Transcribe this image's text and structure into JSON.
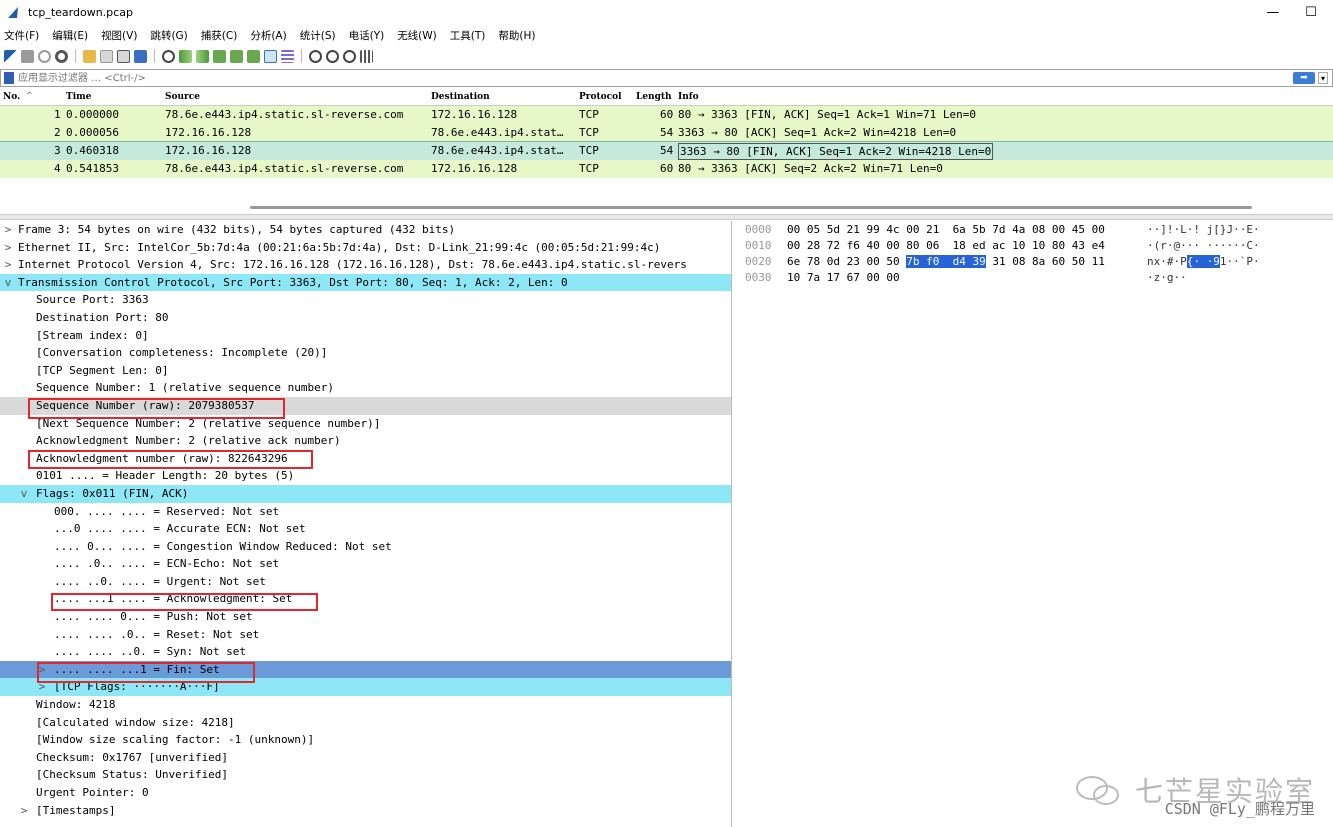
{
  "window": {
    "title": "tcp_teardown.pcap",
    "minimize": "—",
    "maximize": "☐"
  },
  "menu": [
    "文件(F)",
    "编辑(E)",
    "视图(V)",
    "跳转(G)",
    "捕获(C)",
    "分析(A)",
    "统计(S)",
    "电话(Y)",
    "无线(W)",
    "工具(T)",
    "帮助(H)"
  ],
  "filter": {
    "placeholder": "应用显示过滤器 … <Ctrl-/>",
    "apply_icon": "arrow-right-icon",
    "dropdown": "▾"
  },
  "packet_list": {
    "headers": {
      "no": "No.",
      "time": "Time",
      "source": "Source",
      "destination": "Destination",
      "protocol": "Protocol",
      "length": "Length",
      "info": "Info"
    },
    "rows": [
      {
        "no": "1",
        "time": "0.000000",
        "source": "78.6e.e443.ip4.static.sl-reverse.com",
        "destination": "172.16.16.128",
        "protocol": "TCP",
        "length": "60",
        "info": "80 → 3363 [FIN, ACK] Seq=1 Ack=1 Win=71 Len=0"
      },
      {
        "no": "2",
        "time": "0.000056",
        "source": "172.16.16.128",
        "destination": "78.6e.e443.ip4.stat…",
        "protocol": "TCP",
        "length": "54",
        "info": "3363 → 80 [ACK] Seq=1 Ack=2 Win=4218 Len=0"
      },
      {
        "no": "3",
        "time": "0.460318",
        "source": "172.16.16.128",
        "destination": "78.6e.e443.ip4.stat…",
        "protocol": "TCP",
        "length": "54",
        "info": "3363 → 80 [FIN, ACK] Seq=1 Ack=2 Win=4218 Len=0"
      },
      {
        "no": "4",
        "time": "0.541853",
        "source": "78.6e.e443.ip4.static.sl-reverse.com",
        "destination": "172.16.16.128",
        "protocol": "TCP",
        "length": "60",
        "info": "80 → 3363 [ACK] Seq=2 Ack=2 Win=71 Len=0"
      }
    ]
  },
  "details": [
    {
      "text": "Frame 3: 54 bytes on wire (432 bits), 54 bytes captured (432 bits)",
      "arrow": ">"
    },
    {
      "text": "Ethernet II, Src: IntelCor_5b:7d:4a (00:21:6a:5b:7d:4a), Dst: D-Link_21:99:4c (00:05:5d:21:99:4c)",
      "arrow": ">"
    },
    {
      "text": "Internet Protocol Version 4, Src: 172.16.16.128 (172.16.16.128), Dst: 78.6e.e443.ip4.static.sl-revers",
      "arrow": ">"
    },
    {
      "text": "Transmission Control Protocol, Src Port: 3363, Dst Port: 80, Seq: 1, Ack: 2, Len: 0",
      "arrow": "v"
    },
    {
      "text": "Source Port: 3363"
    },
    {
      "text": "Destination Port: 80"
    },
    {
      "text": "[Stream index: 0]"
    },
    {
      "text": "[Conversation completeness: Incomplete (20)]"
    },
    {
      "text": "[TCP Segment Len: 0]"
    },
    {
      "text": "Sequence Number: 1    (relative sequence number)"
    },
    {
      "text": "Sequence Number (raw): 2079380537"
    },
    {
      "text": "[Next Sequence Number: 2    (relative sequence number)]"
    },
    {
      "text": "Acknowledgment Number: 2    (relative ack number)"
    },
    {
      "text": "Acknowledgment number (raw): 822643296"
    },
    {
      "text": "0101 .... = Header Length: 20 bytes (5)"
    },
    {
      "text": "Flags: 0x011 (FIN, ACK)",
      "arrow": "v"
    },
    {
      "text": "000. .... .... = Reserved: Not set"
    },
    {
      "text": "...0 .... .... = Accurate ECN: Not set"
    },
    {
      "text": ".... 0... .... = Congestion Window Reduced: Not set"
    },
    {
      "text": ".... .0.. .... = ECN-Echo: Not set"
    },
    {
      "text": ".... ..0. .... = Urgent: Not set"
    },
    {
      "text": ".... ...1 .... = Acknowledgment: Set"
    },
    {
      "text": ".... .... 0... = Push: Not set"
    },
    {
      "text": ".... .... .0.. = Reset: Not set"
    },
    {
      "text": ".... .... ..0. = Syn: Not set"
    },
    {
      "text": ".... .... ...1 = Fin: Set",
      "arrow": ">"
    },
    {
      "text": "[TCP Flags: ·······A···F]",
      "arrow": ">"
    },
    {
      "text": "Window: 4218"
    },
    {
      "text": "[Calculated window size: 4218]"
    },
    {
      "text": "[Window size scaling factor: -1 (unknown)]"
    },
    {
      "text": "Checksum: 0x1767 [unverified]"
    },
    {
      "text": "[Checksum Status: Unverified]"
    },
    {
      "text": "Urgent Pointer: 0"
    },
    {
      "text": "[Timestamps]",
      "arrow": ">"
    }
  ],
  "bytes": [
    {
      "offset": "0000",
      "hex_a": "00 05 5d 21 99 4c 00 21  6a 5b 7d 4a 08 00 45 00",
      "hex_hl": "",
      "hex_b": "",
      "ascii_a": "··]!·L·! j[}J··E·",
      "ascii_hl": "",
      "ascii_b": ""
    },
    {
      "offset": "0010",
      "hex_a": "00 28 72 f6 40 00 80 06  18 ed ac 10 10 80 43 e4",
      "hex_hl": "",
      "hex_b": "",
      "ascii_a": "·(r·@··· ······C·",
      "ascii_hl": "",
      "ascii_b": ""
    },
    {
      "offset": "0020",
      "hex_a": "6e 78 0d 23 00 50 ",
      "hex_hl": "7b f0  d4 39",
      "hex_b": " 31 08 8a 60 50 11",
      "ascii_a": "nx·#·P",
      "ascii_hl": "{· ·9",
      "ascii_b": "1··`P·"
    },
    {
      "offset": "0030",
      "hex_a": "10 7a 17 67 00 00",
      "hex_hl": "",
      "hex_b": "",
      "ascii_a": "·z·g··",
      "ascii_hl": "",
      "ascii_b": ""
    }
  ],
  "watermark": {
    "brand": "七芒星实验室",
    "csdn": "CSDN @FLy_鹏程万里"
  },
  "colors": {
    "packet_bg": "#e7f8c8",
    "selected_packet": "#c5e9dc",
    "expanded_hl": "#8ee7f7",
    "selected_field": "#6b9ad9",
    "annotation": "#e0282e"
  }
}
